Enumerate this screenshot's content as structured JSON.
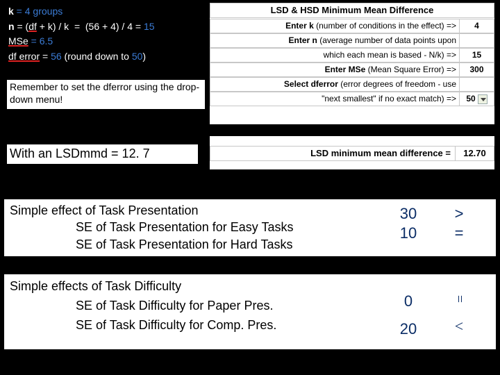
{
  "formulas": {
    "line1_lead": "k",
    "line1_rest": " = 4 groups",
    "line2": "n = (df + k) / k   =   (56 + 4) / 4 = 15",
    "line2_html": "<span class='b'>n</span> <span class='w'>= (</span><span class='red-ul'>df</span><span class='w'> + k) / k   =   (56 + 4) / 4 = </span><span class='bl'>15</span>",
    "line3_lead": "MSe",
    "line3_rest": " = 6.5",
    "line4_pre": "df error",
    "line4_mid": " = ",
    "line4_val": "56",
    "line4_note": " (round down to ",
    "line4_note_val": "50",
    "line4_note_end": ")"
  },
  "remember": "Remember to set the dferror using the drop-down menu!",
  "lsdline": "With an LSDmmd = 12. 7",
  "sheet": {
    "title": "LSD & HSD Minimum Mean Difference",
    "rows": [
      {
        "bold": "Enter k",
        "rest": " (number of conditions in the effect) =>",
        "val": "4"
      },
      {
        "bold": "Enter n",
        "rest": " (average number of data points upon",
        "val": ""
      },
      {
        "bold": "",
        "rest": "which each mean is based - N/k) =>",
        "val": "15"
      },
      {
        "bold": "Enter MSe",
        "rest": " (Mean Square Error) =>",
        "val": "300"
      },
      {
        "bold": "Select dferror",
        "rest": " (error degrees of freedom - use",
        "val": ""
      },
      {
        "bold": "",
        "rest": "\"next smallest\" if no exact match) =>",
        "val": "50",
        "dropdown": true
      }
    ]
  },
  "result": {
    "label": "LSD minimum mean difference =",
    "value": "12.70"
  },
  "eff1": {
    "title": "Simple effect of Task Presentation",
    "subA": "SE of Task Presentation for Easy Tasks",
    "subB": "SE of Task Presentation for Hard Tasks",
    "valA": "30",
    "valB": "10",
    "symA": ">",
    "symB": "="
  },
  "eff2": {
    "title": "Simple effects of Task Difficulty",
    "subA": "SE of Task Difficulty for Paper Pres.",
    "subB": "SE of Task Difficulty for Comp. Pres.",
    "valA": "0",
    "valB": "20",
    "symA": "=",
    "symB": "<"
  }
}
